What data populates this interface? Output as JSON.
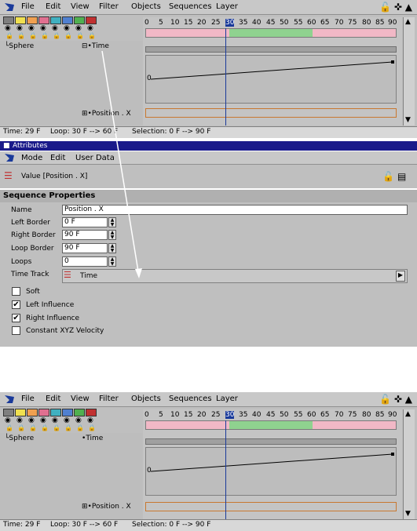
{
  "menus": [
    "File",
    "Edit",
    "View",
    "Filter",
    "Objects",
    "Sequences",
    "Layer"
  ],
  "menu_right_icons": [
    "lock-icon",
    "move-icon",
    "up-icon"
  ],
  "swatch_colors": [
    "#7f7f7f",
    "#f0e050",
    "#f0a050",
    "#e07090",
    "#40b0c0",
    "#5080d0",
    "#50b050",
    "#c03030"
  ],
  "objects": {
    "sphere_label": "Sphere"
  },
  "tracks": {
    "time_label": "Time",
    "position_label": "Position . X"
  },
  "ruler_ticks": [
    "0",
    "5",
    "10",
    "15",
    "20",
    "25",
    "30",
    "35",
    "40",
    "45",
    "50",
    "55",
    "60",
    "65",
    "70",
    "75",
    "80",
    "85",
    "90"
  ],
  "curve_label": "0",
  "status": {
    "time": "Time: 29 F",
    "loop": "Loop: 30 F --> 60 F",
    "selection": "Selection: 0 F --> 90 F"
  },
  "attributes": {
    "title": "Attributes",
    "menu": [
      "Mode",
      "Edit",
      "User Data"
    ],
    "header_value": "Value [Position . X]",
    "section": "Sequence Properties",
    "fields": {
      "name_label": "Name",
      "name_value": "Position . X",
      "left_label": "Left Border",
      "left_value": "0 F",
      "right_label": "Right Border",
      "right_value": "90 F",
      "loop_label": "Loop Border",
      "loop_value": "90 F",
      "loops_label": "Loops",
      "loops_value": "0",
      "timetrack_label": "Time Track",
      "timetrack_value": "Time"
    },
    "checkboxes": [
      {
        "label": "Soft",
        "checked": false
      },
      {
        "label": "Left Influence",
        "checked": true
      },
      {
        "label": "Right Influence",
        "checked": true
      },
      {
        "label": "Constant XYZ Velocity",
        "checked": false
      }
    ]
  }
}
